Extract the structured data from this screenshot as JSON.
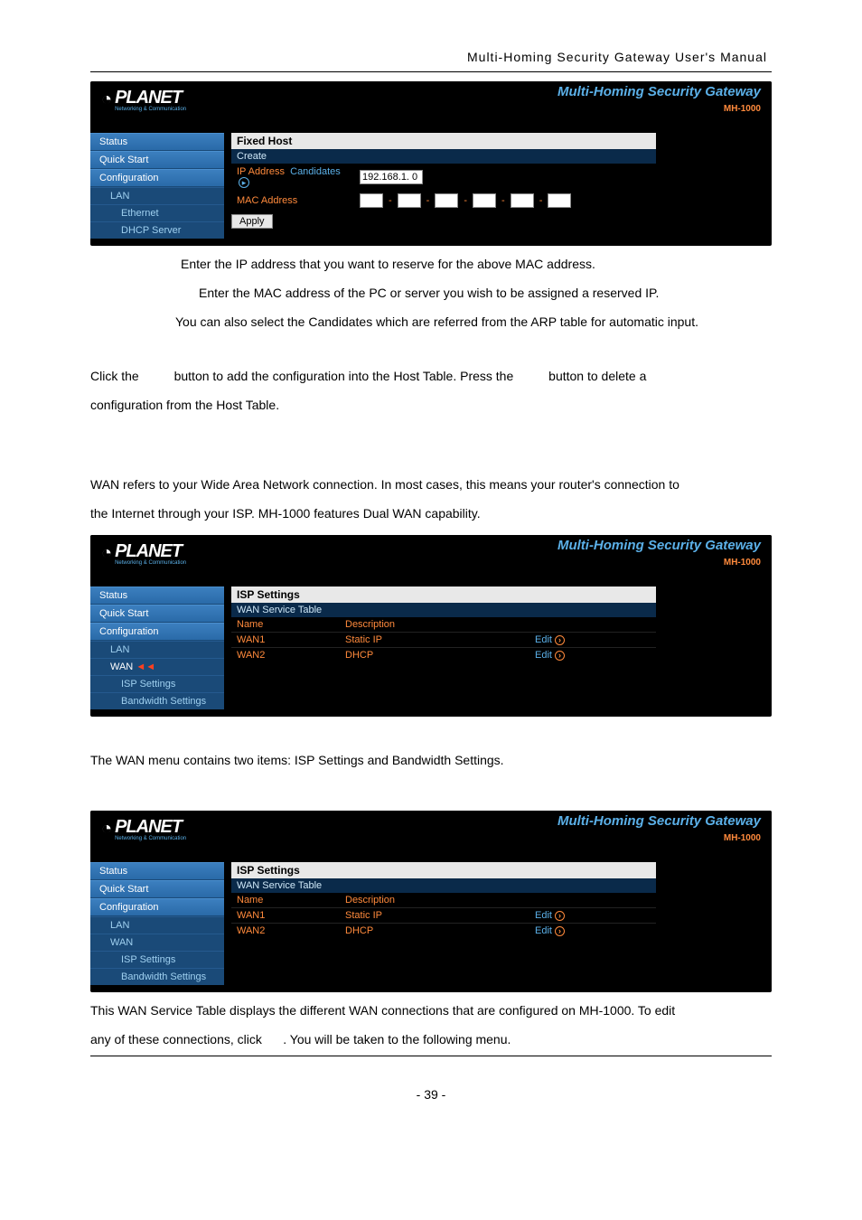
{
  "page_header": "Multi-Homing  Security  Gateway  User's  Manual",
  "brand": {
    "name": "PLANET",
    "tagline": "Networking & Communication"
  },
  "product": {
    "title": "Multi-Homing Security Gateway",
    "model": "MH-1000"
  },
  "sidebar_common": {
    "status": "Status",
    "quick_start": "Quick Start",
    "configuration": "Configuration",
    "lan": "LAN",
    "wan": "WAN",
    "ethernet": "Ethernet",
    "dhcp_server": "DHCP Server",
    "isp_settings": "ISP Settings",
    "bandwidth_settings": "Bandwidth Settings"
  },
  "fixed_host_panel": {
    "title": "Fixed Host",
    "subtitle": "Create",
    "ip_label": "IP Address",
    "candidates": "Candidates",
    "ip_value": "192.168.1. 0",
    "mac_label": "MAC Address",
    "apply": "Apply"
  },
  "isp_panel": {
    "title": "ISP Settings",
    "subtitle": "WAN Service Table",
    "cols": {
      "name": "Name",
      "desc": "Description"
    },
    "rows": [
      {
        "name": "WAN1",
        "desc": "Static IP",
        "action": "Edit"
      },
      {
        "name": "WAN2",
        "desc": "DHCP",
        "action": "Edit"
      }
    ]
  },
  "text": {
    "ip_line": "Enter the IP address that you want to reserve for the above MAC address.",
    "mac_line": "Enter the MAC address of the PC or server you wish to be assigned a reserved IP.",
    "cand_line": "You can also select the Candidates which are referred from the ARP table for automatic input.",
    "click_line_a": "Click the",
    "click_line_b": "button to add the configuration into the Host Table. Press the",
    "click_line_c": "button to delete a",
    "click_line_d": "configuration from the Host Table.",
    "wan_intro_a": "WAN refers to your Wide Area Network connection. In most cases, this means your router's connection to",
    "wan_intro_b": "the Internet through your ISP. MH-1000 features Dual WAN capability.",
    "wan_menu": "The WAN menu contains two items: ISP Settings and Bandwidth Settings.",
    "wan_table_a": "This WAN Service Table displays the different WAN connections that are configured on MH-1000. To edit",
    "wan_table_b": "any of these connections, click",
    "wan_table_c": ". You will be taken to the following menu."
  },
  "footer": "- 39 -"
}
